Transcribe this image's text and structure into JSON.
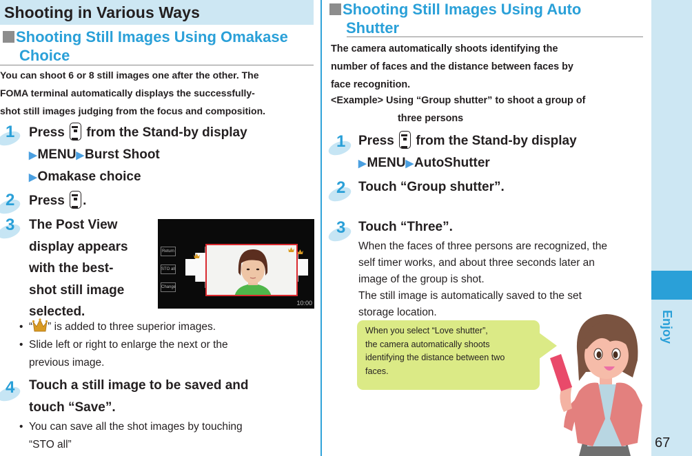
{
  "page": {
    "section_title": "Shooting in Various Ways",
    "side_tab_label": "Enjoy",
    "page_number": "67",
    "accent_color": "#2aa0d8",
    "band_color": "#cde7f3"
  },
  "left": {
    "heading_line1": "Shooting Still Images Using Omakase",
    "heading_line2": "Choice",
    "intro": [
      "You can shoot 6 or 8 still images one after the other. The",
      "FOMA terminal automatically displays the successfully-",
      "shot still images judging from the focus and composition."
    ],
    "steps": [
      {
        "num": "1",
        "line1_pre": "Press",
        "key_icon": "camera-key",
        "line1_post": "from the Stand-by display",
        "line2": [
          "MENU",
          "Burst Shoot"
        ],
        "line3": [
          "Omakase choice"
        ]
      },
      {
        "num": "2",
        "pre": "Press",
        "key_icon": "camera-key",
        "post": "."
      },
      {
        "num": "3",
        "lines": [
          "The Post View",
          "display appears",
          "with the best-",
          "shot still image",
          "selected."
        ],
        "bullets": [
          {
            "pre": "“",
            "icon": "crown",
            "post": "” is added to three superior images."
          },
          {
            "line1": "Slide left or right to enlarge the next or the",
            "line2": "previous image."
          }
        ]
      },
      {
        "num": "4",
        "lines": [
          "Touch a still image to be saved and",
          "touch “Save”."
        ],
        "bullets": [
          {
            "line1": "You can save all the shot images by touching",
            "line2": "“STO all”"
          }
        ]
      }
    ],
    "phone_screen": {
      "buttons": [
        "Return",
        "STO all",
        "Change"
      ],
      "clock": "10:00",
      "selected_frame_color": "#d9292f"
    }
  },
  "right": {
    "heading_line1": "Shooting Still Images Using Auto",
    "heading_line2": "Shutter",
    "intro": [
      "The camera automatically shoots identifying the",
      "number of faces and the distance between faces by",
      "face recognition."
    ],
    "example_label": "<Example>",
    "example_line1": "Using “Group shutter” to shoot a group of",
    "example_line2": "three persons",
    "steps": [
      {
        "num": "1",
        "line1_pre": "Press",
        "key_icon": "camera-key",
        "line1_post": "from the Stand-by display",
        "line2": [
          "MENU",
          "AutoShutter"
        ]
      },
      {
        "num": "2",
        "text": "Touch “Group shutter”."
      },
      {
        "num": "3",
        "text": "Touch “Three”.",
        "body": [
          "When the faces of three persons are recognized, the",
          "self timer works, and about three seconds later an",
          "image of the group is shot.",
          "The still image is automatically saved to the set",
          "storage location."
        ]
      }
    ],
    "bubble": [
      "When you select “Love shutter”,",
      "the camera automatically shoots",
      "identifying the distance between two",
      "faces."
    ],
    "bubble_color": "#dbea86"
  }
}
